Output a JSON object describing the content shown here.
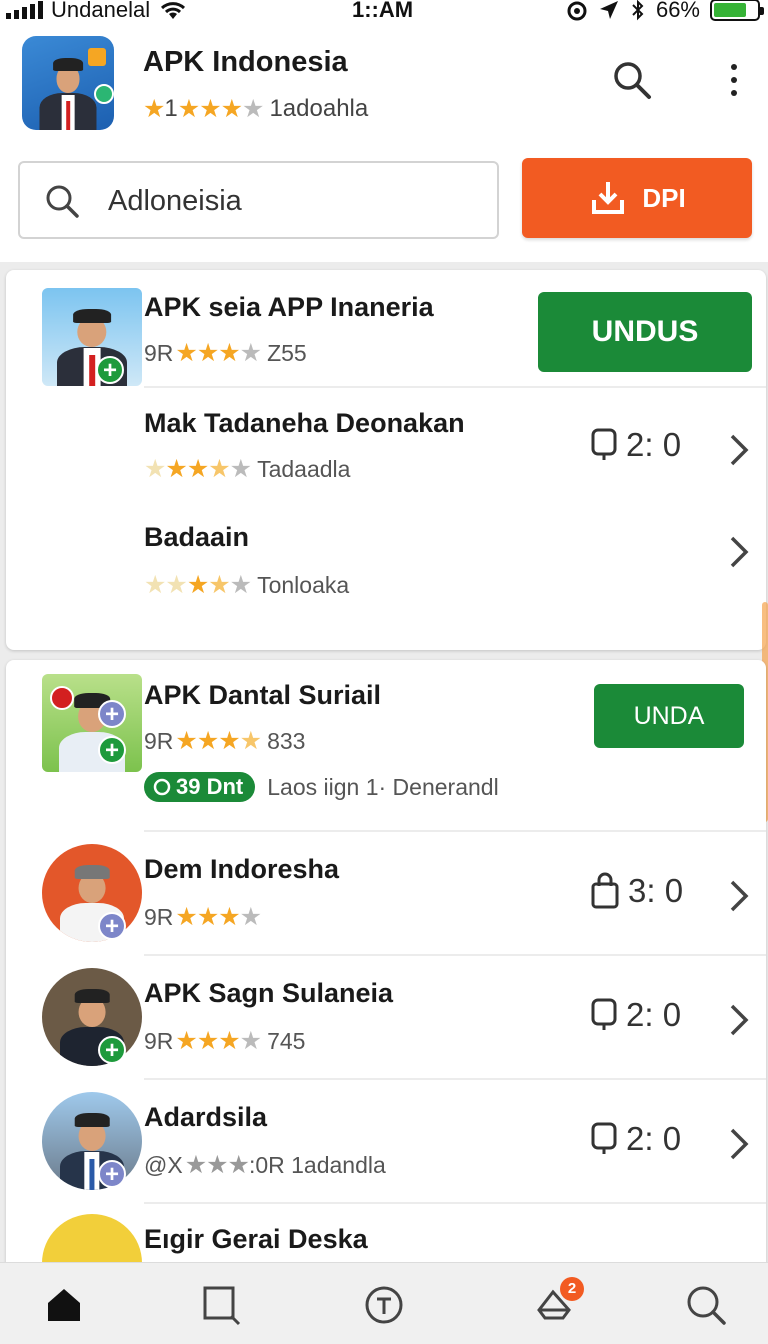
{
  "status_bar": {
    "carrier": "Undanelal",
    "time": "1::AM",
    "battery": "66%"
  },
  "header": {
    "app_title": "APK Indonesia",
    "rating_prefix": "1",
    "rating_label": "1adoahla",
    "search_value": "Adloneisia",
    "download_label": "DPI"
  },
  "card1": {
    "rows": [
      {
        "name": "APK seia APP Inaneria",
        "prefix": "9R",
        "suffix": "Z55",
        "button": "UNDUS"
      },
      {
        "name": "Mak Tadaneha Deonakan",
        "suffix": "Tadaadla",
        "side": "2: 0"
      },
      {
        "name": "Badaain",
        "suffix": "Tonloaka"
      }
    ]
  },
  "card2": {
    "rows": [
      {
        "name": "APK Dantal Suriail",
        "prefix": "9R",
        "suffix": "833",
        "button": "UNDA",
        "tag": "39 Dnt",
        "tag_text": "Laos iign 1· Denerandl"
      },
      {
        "name": "Dem Indoresha",
        "prefix": "9R",
        "side": "3: 0"
      },
      {
        "name": "APK Sagn Sulaneia",
        "prefix": "9R",
        "suffix": "745",
        "side": "2: 0"
      },
      {
        "name": "Adardsila",
        "prefix": "@X",
        "suffix": ":0R 1adandla",
        "side": "2: 0"
      },
      {
        "name": "Eıgir Gerai Deska"
      }
    ]
  },
  "bottom_nav": {
    "items": [
      "home-icon",
      "bookmark-icon",
      "apps-icon",
      "notifications-icon",
      "search-icon"
    ],
    "badge": "2"
  },
  "colors": {
    "accent": "#f25b22",
    "green": "#1b8a38",
    "star": "#f5a623"
  }
}
